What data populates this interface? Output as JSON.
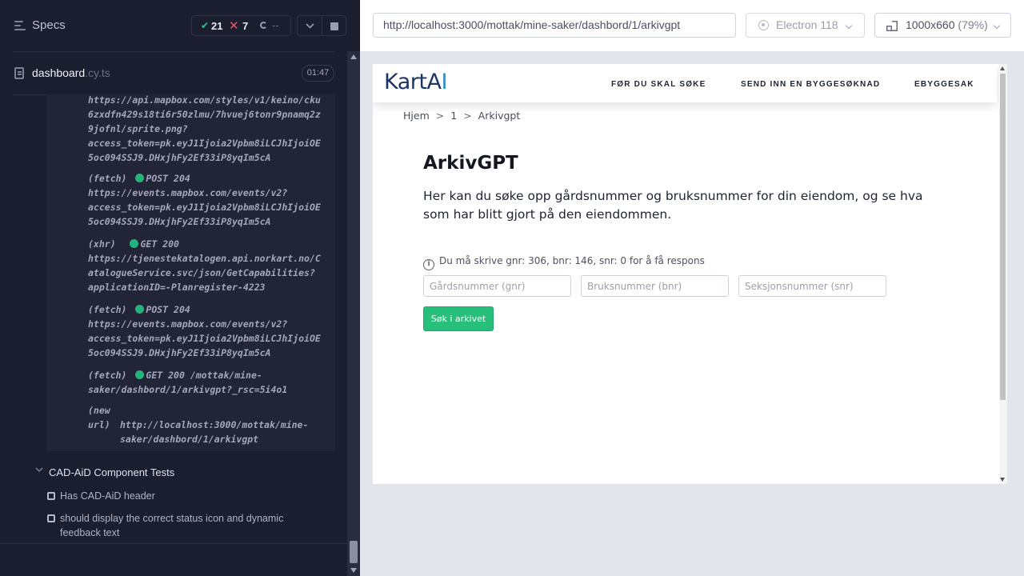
{
  "runner": {
    "specs_title": "Specs",
    "stats": {
      "passed": "21",
      "failed": "7",
      "pending": "--"
    }
  },
  "spec_file": {
    "name": "dashboard",
    "ext": ".cy.ts",
    "duration": "01:47"
  },
  "log": [
    {
      "type": "",
      "method": "",
      "url": "https://api.mapbox.com/styles/v1/keino/cku\n6zxdfn429s18ti6r50zlmu/7hvuej6tonr9pnamq2z\n9jofnl/sprite.png?\naccess_token=pk.eyJ1Ijoia2Vpbm8iLCJhIjoiOE\n5oc094SSJ9.DHxjhFy2Ef33iP8yqIm5cA"
    },
    {
      "type": "(fetch)",
      "method": "POST 204",
      "url": "https://events.mapbox.com/events/v2?\naccess_token=pk.eyJ1Ijoia2Vpbm8iLCJhIjoiOE\n5oc094SSJ9.DHxjhFy2Ef33iP8yqIm5cA"
    },
    {
      "type": "(xhr)",
      "method": "GET 200",
      "url": "https://tjenestekatalogen.api.norkart.no/C\natalogueService.svc/json/GetCapabilities?\napplicationID=-Planregister-4223"
    },
    {
      "type": "(fetch)",
      "method": "POST 204",
      "url": "https://events.mapbox.com/events/v2?\naccess_token=pk.eyJ1Ijoia2Vpbm8iLCJhIjoiOE\n5oc094SSJ9.DHxjhFy2Ef33iP8yqIm5cA"
    },
    {
      "type": "(fetch)",
      "method": "GET 200",
      "url": "/mottak/mine-\nsaker/dashbord/1/arkivgpt?_rsc=5i4o1"
    },
    {
      "type": "(new\nurl)",
      "method": "",
      "url": "http://localhost:3000/mottak/mine-\nsaker/dashbord/1/arkivgpt"
    }
  ],
  "suite": {
    "title": "CAD-AiD Component Tests",
    "tests": [
      {
        "label": "Has CAD-AiD header"
      },
      {
        "label": "should display the correct status icon and dynamic feedback text"
      }
    ]
  },
  "toolbar": {
    "url": "http://localhost:3000/mottak/mine-saker/dashbord/1/arkivgpt",
    "browser": "Electron 118",
    "viewport": "1000x660",
    "viewport_pct": "(79%)"
  },
  "site": {
    "logo_main": "KartA",
    "logo_accent": "I",
    "nav": [
      "FØR DU SKAL SØKE",
      "SEND INN EN BYGGESØKNAD",
      "EBYGGESAK"
    ],
    "breadcrumb": [
      "Hjem",
      ">",
      "1",
      ">",
      "Arkivgpt"
    ],
    "title": "ArkivGPT",
    "description": "Her kan du søke opp gårdsnummer og bruksnummer for din eiendom, og se hva som har blitt gjort på den eiendommen.",
    "hint_icon": "i",
    "hint": "Du må skrive gnr: 306, bnr: 146, snr: 0 for å få respons",
    "fields": [
      {
        "placeholder": "Gårdsnummer (gnr)",
        "value": ""
      },
      {
        "placeholder": "Bruksnummer (bnr)",
        "value": ""
      },
      {
        "placeholder": "Seksjonsnummer (snr)",
        "value": ""
      }
    ],
    "search_button": "Søk i arkivet"
  },
  "icons": {
    "specs": "list-icon",
    "pass": "check-icon",
    "fail": "x-icon",
    "pending": "spinner-icon",
    "file": "file-icon",
    "browser": "electron-icon",
    "viewport": "viewport-icon",
    "hint": "info-icon"
  },
  "colors": {
    "pass": "#35c58c",
    "fail": "#e45770",
    "status_dot": "#24b37a",
    "button": "#27c07a",
    "logo": "#1d3566",
    "logo_accent": "#2a8fc4"
  }
}
